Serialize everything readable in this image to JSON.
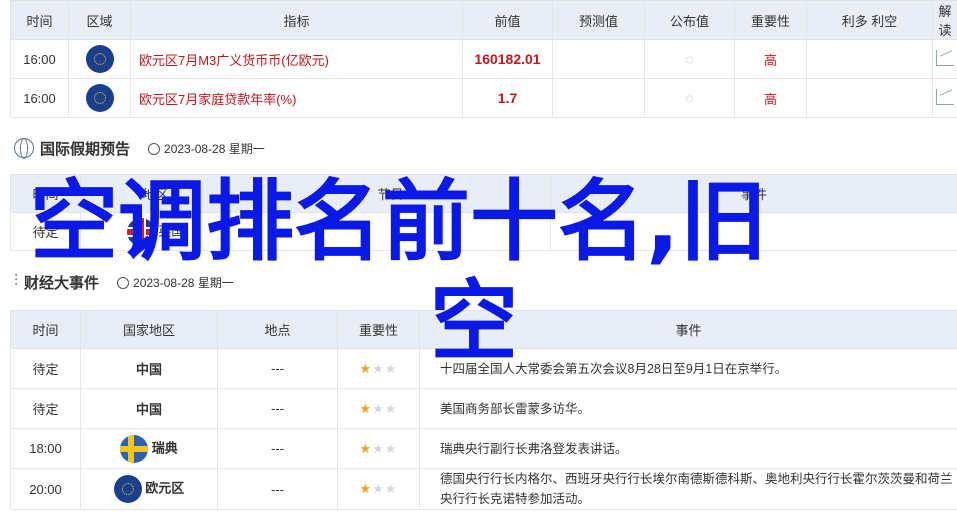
{
  "calendar": {
    "headers": [
      "时间",
      "区域",
      "指标",
      "前值",
      "预测值",
      "公布值",
      "重要性",
      "利多 利空",
      "解读"
    ],
    "rows": [
      {
        "time": "16:00",
        "flag": "eu-flag",
        "indicator": "欧元区7月M3广义货币币(亿欧元)",
        "prev": "160182.01",
        "forecast": "",
        "actual": "◌",
        "importance": "高",
        "bull_bear": ""
      },
      {
        "time": "16:00",
        "flag": "eu-flag",
        "indicator": "欧元区7月家庭贷款年率(%)",
        "prev": "1.7",
        "forecast": "",
        "actual": "◌",
        "importance": "高",
        "bull_bear": ""
      }
    ]
  },
  "holiday": {
    "title": "国际假期预告",
    "date": "2023-08-28 星期一",
    "headers": [
      "时间",
      "地区",
      "节日",
      "事件"
    ],
    "rows": [
      {
        "time": "待定",
        "region": "英国",
        "holiday": "",
        "event": ""
      }
    ]
  },
  "events": {
    "title": "财经大事件",
    "date": "2023-08-28 星期一",
    "headers": [
      "时间",
      "国家地区",
      "地点",
      "重要性",
      "事件"
    ],
    "rows": [
      {
        "time": "待定",
        "region": "中国",
        "place": "---",
        "stars": 1,
        "event": "十四届全国人大常委会第五次会议8月28日至9月1日在京举行。"
      },
      {
        "time": "待定",
        "region": "中国",
        "place": "---",
        "stars": 1,
        "event": "美国商务部长雷蒙多访华。"
      },
      {
        "time": "18:00",
        "region": "瑞典",
        "place": "---",
        "stars": 1,
        "event": "瑞典央行副行长弗洛登发表讲话。"
      },
      {
        "time": "20:00",
        "region": "欧元区",
        "place": "---",
        "stars": 1,
        "event": "德国央行行长内格尔、西班牙央行行长埃尔南德斯德科斯、奥地利央行行长霍尔茨茨曼和荷兰央行行长克诺特参加活动。"
      }
    ]
  },
  "overlay": {
    "line1": "空调排名前十名,旧",
    "line2": "空"
  },
  "colors": {
    "accent_red": "#c0171d",
    "overlay_blue": "#0a19e6",
    "header_bg": "#e9edf5"
  }
}
